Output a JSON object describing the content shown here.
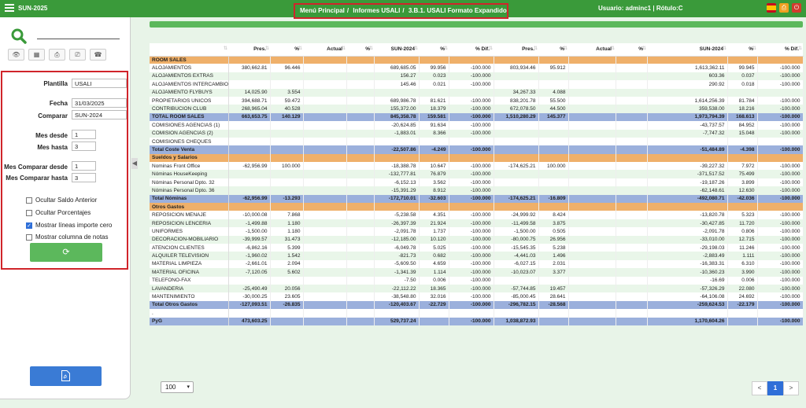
{
  "app": {
    "name": "SUN-2025"
  },
  "breadcrumb": {
    "item1": "Menú Principal",
    "item2": "Informes USALI",
    "item3": "3.B.1. USALI Formato Expandido",
    "sep": "/"
  },
  "user": {
    "text": "Usuario: adminc1 | Rótulo:C"
  },
  "sidebar": {
    "plantilla_label": "Plantilla",
    "plantilla_value": "USALI",
    "fecha_label": "Fecha",
    "fecha_value": "31/03/2025",
    "comparar_label": "Comparar",
    "comparar_value": "SUN-2024",
    "mes_desde_label": "Mes desde",
    "mes_desde_value": "1",
    "mes_hasta_label": "Mes hasta",
    "mes_hasta_value": "3",
    "mes_comp_desde_label": "Mes Comparar desde",
    "mes_comp_desde_value": "1",
    "mes_comp_hasta_label": "Mes Comparar hasta",
    "mes_comp_hasta_value": "3",
    "checks": [
      {
        "label": "Ocultar Saldo Anterior",
        "checked": false
      },
      {
        "label": "Ocultar Porcentajes",
        "checked": false
      },
      {
        "label": "Mostrar líneas importe cero",
        "checked": true
      },
      {
        "label": "Mostrar columna de notas",
        "checked": false
      }
    ]
  },
  "table": {
    "headers": [
      "",
      "Pres.",
      "%",
      "Actual",
      "%",
      "SUN-2024",
      "%",
      "% Dif.",
      "Pres.",
      "%",
      "Actual",
      "%",
      "SUN-2024",
      "%",
      "% Dif."
    ],
    "rows": [
      {
        "type": "grp",
        "cells": [
          "ROOM SALES",
          "",
          "",
          "",
          "",
          "",
          "",
          "",
          "",
          "",
          "",
          "",
          "",
          "",
          ""
        ]
      },
      {
        "type": "r0",
        "cells": [
          "ALOJAMIENTOS",
          "380,662.81",
          "96.446",
          "",
          "",
          "689,685.05",
          "99.956",
          "-100.000",
          "803,934.46",
          "95.912",
          "",
          "",
          "1,613,362.11",
          "99.945",
          "-100.000"
        ]
      },
      {
        "type": "r1",
        "cells": [
          "ALOJAMIENTOS EXTRAS",
          "",
          "",
          "",
          "",
          "156.27",
          "0.023",
          "-100.000",
          "",
          "",
          "",
          "",
          "603.36",
          "0.037",
          "-100.000"
        ]
      },
      {
        "type": "r0",
        "cells": [
          "ALOJAMIENTOS INTERCAMBIO",
          "",
          "",
          "",
          "",
          "145.46",
          "0.021",
          "-100.000",
          "",
          "",
          "",
          "",
          "290.92",
          "0.018",
          "-100.000"
        ]
      },
      {
        "type": "r1",
        "cells": [
          "ALOJAMIENTO FLYBUYS",
          "14,025.90",
          "3.554",
          "",
          "",
          "",
          "",
          "",
          "34,267.33",
          "4.088",
          "",
          "",
          "",
          "",
          ""
        ]
      },
      {
        "type": "r0",
        "cells": [
          "PROPIETARIOS UNICOS",
          "394,688.71",
          "59.472",
          "",
          "",
          "689,986.78",
          "81.621",
          "-100.000",
          "838,201.78",
          "55.500",
          "",
          "",
          "1,614,256.39",
          "81.784",
          "-100.000"
        ]
      },
      {
        "type": "r1",
        "cells": [
          "CONTRIBUCION CLUB",
          "268,965.04",
          "40.528",
          "",
          "",
          "155,372.00",
          "18.379",
          "-100.000",
          "672,078.50",
          "44.500",
          "",
          "",
          "359,538.00",
          "18.216",
          "-100.000"
        ]
      },
      {
        "type": "tot",
        "cells": [
          "TOTAL ROOM SALES",
          "663,653.75",
          "140.129",
          "",
          "",
          "845,358.78",
          "159.581",
          "-100.000",
          "1,510,280.29",
          "145.377",
          "",
          "",
          "1,973,794.39",
          "168.613",
          "-100.000"
        ]
      },
      {
        "type": "r0",
        "cells": [
          "COMISIONES AGENCIAS (1)",
          "",
          "",
          "",
          "",
          "-20,624.85",
          "91.634",
          "-100.000",
          "",
          "",
          "",
          "",
          "-43,737.57",
          "84.952",
          "-100.000"
        ]
      },
      {
        "type": "r1",
        "cells": [
          "COMISION AGENCIAS (2)",
          "",
          "",
          "",
          "",
          "-1,883.01",
          "8.366",
          "-100.000",
          "",
          "",
          "",
          "",
          "-7,747.32",
          "15.048",
          "-100.000"
        ]
      },
      {
        "type": "r0",
        "cells": [
          "COMISIONES CHEQUES",
          "",
          "",
          "",
          "",
          "",
          "",
          "",
          "",
          "",
          "",
          "",
          "",
          "",
          ""
        ]
      },
      {
        "type": "tot",
        "cells": [
          "Total Coste Venta",
          "",
          "",
          "",
          "",
          "-22,507.86",
          "-4.249",
          "-100.000",
          "",
          "",
          "",
          "",
          "-51,484.89",
          "-4.398",
          "-100.000"
        ]
      },
      {
        "type": "grp",
        "cells": [
          "Sueldos y Salarios",
          "",
          "",
          "",
          "",
          "",
          "",
          "",
          "",
          "",
          "",
          "",
          "",
          "",
          ""
        ]
      },
      {
        "type": "r0",
        "cells": [
          "Nominas Front Office",
          "-62,956.99",
          "100.000",
          "",
          "",
          "-18,388.78",
          "10.647",
          "-100.000",
          "-174,625.21",
          "100.000",
          "",
          "",
          "-39,227.32",
          "7.972",
          "-100.000"
        ]
      },
      {
        "type": "r1",
        "cells": [
          "Nóminas HouseKeeping",
          "",
          "",
          "",
          "",
          "-132,777.81",
          "76.879",
          "-100.000",
          "",
          "",
          "",
          "",
          "-371,517.52",
          "75.499",
          "-100.000"
        ]
      },
      {
        "type": "r0",
        "cells": [
          "Nóminas Personal Dpto. 32",
          "",
          "",
          "",
          "",
          "-6,152.13",
          "3.562",
          "-100.000",
          "",
          "",
          "",
          "",
          "-19,187.26",
          "3.899",
          "-100.000"
        ]
      },
      {
        "type": "r1",
        "cells": [
          "Nóminas Personal Dpto. 36",
          "",
          "",
          "",
          "",
          "-15,391.29",
          "8.912",
          "-100.000",
          "",
          "",
          "",
          "",
          "-62,148.61",
          "12.630",
          "-100.000"
        ]
      },
      {
        "type": "tot",
        "cells": [
          "Total Nóminas",
          "-62,956.99",
          "-13.293",
          "",
          "",
          "-172,710.01",
          "-32.603",
          "-100.000",
          "-174,625.21",
          "-16.809",
          "",
          "",
          "-492,080.71",
          "-42.036",
          "-100.000"
        ]
      },
      {
        "type": "grp",
        "cells": [
          "Otros Gastos",
          "",
          "",
          "",
          "",
          "",
          "",
          "",
          "",
          "",
          "",
          "",
          "",
          "",
          ""
        ]
      },
      {
        "type": "r0",
        "cells": [
          "REPOSICION MENAJE",
          "-10,000.08",
          "7.868",
          "",
          "",
          "-5,238.58",
          "4.351",
          "-100.000",
          "-24,999.92",
          "8.424",
          "",
          "",
          "-13,820.78",
          "5.323",
          "-100.000"
        ]
      },
      {
        "type": "r1",
        "cells": [
          "REPOSICION LENCERIA",
          "-1,499.88",
          "1.180",
          "",
          "",
          "-26,397.39",
          "21.924",
          "-100.000",
          "-11,499.58",
          "3.875",
          "",
          "",
          "-30,427.85",
          "11.720",
          "-100.000"
        ]
      },
      {
        "type": "r0",
        "cells": [
          "UNIFORMES",
          "-1,500.00",
          "1.180",
          "",
          "",
          "-2,091.78",
          "1.737",
          "-100.000",
          "-1,500.00",
          "0.505",
          "",
          "",
          "-2,091.78",
          "0.806",
          "-100.000"
        ]
      },
      {
        "type": "r1",
        "cells": [
          "DECORACION-MOBILIARIO",
          "-39,999.57",
          "31.473",
          "",
          "",
          "-12,185.00",
          "10.120",
          "-100.000",
          "-80,000.75",
          "26.956",
          "",
          "",
          "-33,010.00",
          "12.715",
          "-100.000"
        ]
      },
      {
        "type": "r0",
        "cells": [
          "ATENCION CLIENTES",
          "-6,862.16",
          "5.399",
          "",
          "",
          "-6,049.78",
          "5.025",
          "-100.000",
          "-15,545.35",
          "5.238",
          "",
          "",
          "-29,198.03",
          "11.246",
          "-100.000"
        ]
      },
      {
        "type": "r1",
        "cells": [
          "ALQUILER TELEVISION",
          "-1,960.02",
          "1.542",
          "",
          "",
          "-821.73",
          "0.682",
          "-100.000",
          "-4,441.03",
          "1.496",
          "",
          "",
          "-2,883.49",
          "1.111",
          "-100.000"
        ]
      },
      {
        "type": "r0",
        "cells": [
          "MATERIAL LIMPIEZA",
          "-2,661.01",
          "2.094",
          "",
          "",
          "-5,609.50",
          "4.659",
          "-100.000",
          "-6,027.15",
          "2.031",
          "",
          "",
          "-16,383.31",
          "6.310",
          "-100.000"
        ]
      },
      {
        "type": "r1",
        "cells": [
          "MATERIAL OFICINA",
          "-7,120.05",
          "5.602",
          "",
          "",
          "-1,341.39",
          "1.114",
          "-100.000",
          "-10,023.07",
          "3.377",
          "",
          "",
          "-10,360.23",
          "3.990",
          "-100.000"
        ]
      },
      {
        "type": "r0",
        "cells": [
          "TELEFONO-FAX",
          "",
          "",
          "",
          "",
          "-7.50",
          "0.006",
          "-100.000",
          "",
          "",
          "",
          "",
          "-16.69",
          "0.006",
          "-100.000"
        ]
      },
      {
        "type": "r1",
        "cells": [
          "LAVANDERIA",
          "-25,490.49",
          "20.056",
          "",
          "",
          "-22,112.22",
          "18.365",
          "-100.000",
          "-57,744.85",
          "19.457",
          "",
          "",
          "-57,326.29",
          "22.080",
          "-100.000"
        ]
      },
      {
        "type": "r0",
        "cells": [
          "MANTENIMIENTO",
          "-30,000.25",
          "23.605",
          "",
          "",
          "-38,548.80",
          "32.016",
          "-100.000",
          "-85,000.45",
          "28.641",
          "",
          "",
          "-64,106.08",
          "24.692",
          "-100.000"
        ]
      },
      {
        "type": "tot",
        "cells": [
          "Total Otros Gastos",
          "-127,093.51",
          "-26.835",
          "",
          "",
          "-120,403.67",
          "-22.729",
          "-100.000",
          "-296,782.15",
          "-28.568",
          "",
          "",
          "-259,624.53",
          "-22.179",
          "-100.000"
        ]
      },
      {
        "type": "blank",
        "cells": [
          ".",
          "",
          "",
          "",
          "",
          "",
          "",
          "",
          "",
          "",
          "",
          "",
          "",
          "",
          ""
        ]
      },
      {
        "type": "tot",
        "cells": [
          "PyG",
          "473,603.25",
          "",
          "",
          "",
          "529,737.24",
          "",
          "-100.000",
          "1,038,872.93",
          "",
          "",
          "",
          "1,170,604.26",
          "",
          "-100.000"
        ]
      }
    ]
  },
  "footer": {
    "page_size": "100",
    "prev": "<",
    "page": "1",
    "next": ">"
  },
  "colors": {
    "topbar": "#3a9a3a",
    "group_row": "#efb06a",
    "total_row": "#9bb0dc",
    "highlight": "#d0242a"
  }
}
